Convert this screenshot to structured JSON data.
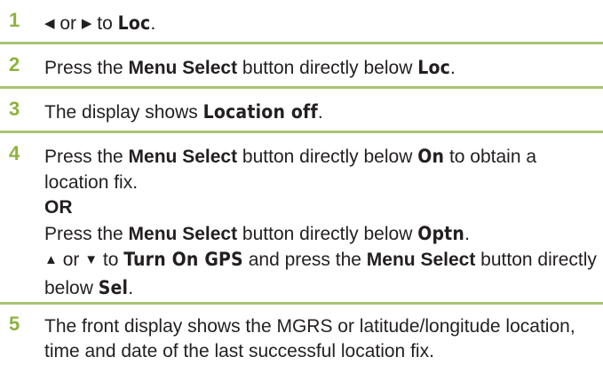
{
  "steps": [
    {
      "number": "1",
      "parts": {
        "left_arrow": "◀",
        "or": " or ",
        "right_arrow": "▶",
        "to": " to ",
        "target": "Loc",
        "end": "."
      }
    },
    {
      "number": "2",
      "parts": {
        "press": "Press the ",
        "button": "Menu Select",
        "mid": " button directly below ",
        "target": "Loc",
        "end": "."
      }
    },
    {
      "number": "3",
      "parts": {
        "lead": "The display shows ",
        "target": "Location off",
        "end": "."
      }
    },
    {
      "number": "4",
      "parts": {
        "press": "Press the ",
        "button": "Menu Select",
        "mid": " button directly below ",
        "target": "On",
        "tail": " to obtain a location fix.",
        "or_label": "OR",
        "press2": "Press the ",
        "button2": "Menu Select",
        "mid2": " button directly below ",
        "target2": "Optn",
        "end2": ".",
        "up_arrow": "▲",
        "or3": " or ",
        "down_arrow": "▼",
        "to3": " to ",
        "target3": "Turn On GPS",
        "and_press": " and press the ",
        "button3": "Menu Select",
        "mid3": " button directly below ",
        "target4": "Sel",
        "end4": "."
      }
    },
    {
      "number": "5",
      "parts": {
        "text": "The front display shows the MGRS or latitude/longitude location, time and date of the last successful location fix."
      }
    }
  ],
  "colors": {
    "step_number": "#8bb33c",
    "separator": "#a8c373",
    "text": "#231f20"
  }
}
